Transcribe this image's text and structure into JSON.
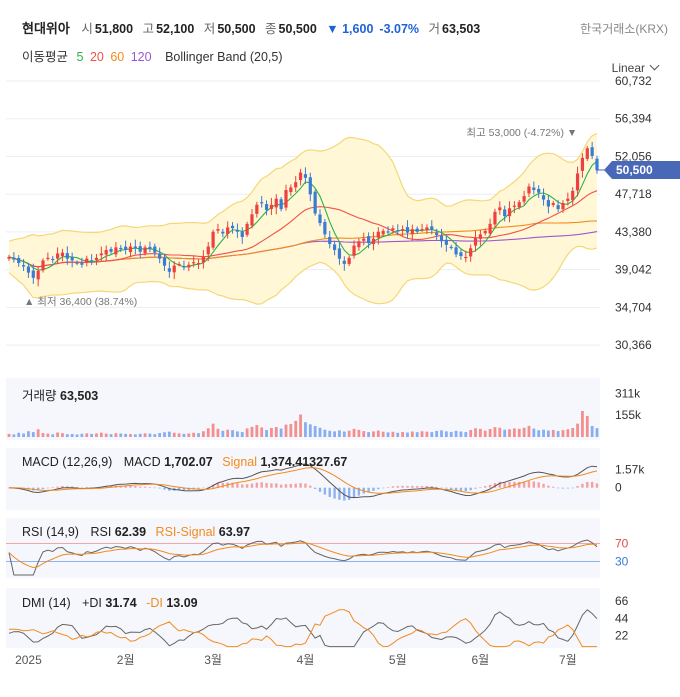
{
  "header": {
    "name": "현대위아",
    "open_label": "시",
    "open": "51,800",
    "high_label": "고",
    "high": "52,100",
    "low_label": "저",
    "low": "50,500",
    "close_label": "종",
    "close": "50,500",
    "change": "▼ 1,600",
    "change_pct": "-3.07%",
    "volume_label": "거",
    "volume": "63,503",
    "exchange": "한국거래소(KRX)"
  },
  "legend": {
    "ma_label": "이동평균",
    "ma_periods": [
      {
        "label": "5",
        "color": "#2bb24c"
      },
      {
        "label": "20",
        "color": "#f2504b"
      },
      {
        "label": "60",
        "color": "#f28b1e"
      },
      {
        "label": "120",
        "color": "#9b59d0"
      }
    ],
    "bb_label": "Bollinger Band (20,5)"
  },
  "scale_mode": "Linear",
  "colors": {
    "up": "#ef3f3f",
    "down": "#3a7bd5",
    "band_fill": "#fff7d6",
    "band_line": "#f5d77a",
    "tag_bg": "#4a68b8"
  },
  "chart_data": [
    {
      "type": "candlestick",
      "title": "",
      "y_ticks": [
        "60,732",
        "56,394",
        "52,056",
        "47,718",
        "43,380",
        "39,042",
        "34,704",
        "30,366"
      ],
      "ylim": [
        27500,
        62000
      ],
      "x_ticks": [
        "2025",
        "2월",
        "3월",
        "4월",
        "5월",
        "6월",
        "7월"
      ],
      "last_price_tag": "50,500",
      "annotations": {
        "max": "최고 53,000 (-4.72%)",
        "min": "최저 36,400 (38.74%)"
      },
      "close": [
        40500,
        40200,
        39800,
        39400,
        38700,
        38100,
        38900,
        40100,
        40400,
        40200,
        40900,
        41000,
        40300,
        40100,
        39800,
        39600,
        40300,
        40100,
        40400,
        40900,
        41300,
        41100,
        41600,
        41500,
        41300,
        41700,
        41500,
        41100,
        41600,
        41400,
        41000,
        40300,
        39500,
        38800,
        39500,
        39700,
        39300,
        39600,
        39900,
        39800,
        40500,
        41700,
        43400,
        43700,
        43200,
        43900,
        43800,
        43400,
        42800,
        44300,
        45400,
        46500,
        46700,
        45900,
        46500,
        47200,
        46000,
        48200,
        48500,
        49100,
        50200,
        49600,
        47700,
        45500,
        44400,
        43100,
        42000,
        41300,
        40300,
        39700,
        40400,
        41800,
        42300,
        42600,
        42100,
        42600,
        43400,
        43500,
        43400,
        43800,
        43500,
        43700,
        43300,
        43700,
        43400,
        43700,
        43900,
        43600,
        43000,
        42300,
        41900,
        41600,
        40800,
        40600,
        40500,
        41500,
        42700,
        43100,
        43500,
        44300,
        45700,
        46200,
        45200,
        46100,
        46400,
        46800,
        47500,
        48600,
        48200,
        47900,
        47100,
        46300,
        46700,
        46000,
        46700,
        47200,
        48100,
        50100,
        51900,
        53000,
        52100,
        50500
      ],
      "volume": [
        22,
        18,
        30,
        25,
        41,
        35,
        55,
        28,
        24,
        19,
        32,
        27,
        20,
        21,
        18,
        23,
        26,
        22,
        25,
        31,
        24,
        20,
        27,
        25,
        22,
        21,
        19,
        23,
        26,
        24,
        20,
        28,
        34,
        38,
        30,
        26,
        22,
        25,
        30,
        27,
        41,
        62,
        95,
        58,
        44,
        52,
        49,
        40,
        35,
        61,
        72,
        85,
        68,
        50,
        64,
        71,
        60,
        88,
        92,
        115,
        160,
        105,
        90,
        78,
        66,
        52,
        44,
        40,
        47,
        39,
        45,
        58,
        51,
        42,
        35,
        40,
        46,
        38,
        33,
        37,
        30,
        36,
        32,
        39,
        34,
        41,
        38,
        35,
        43,
        47,
        40,
        36,
        44,
        39,
        35,
        50,
        62,
        58,
        45,
        57,
        70,
        66,
        52,
        55,
        61,
        58,
        66,
        79,
        60,
        48,
        52,
        46,
        50,
        42,
        49,
        55,
        64,
        95,
        185,
        150,
        78,
        63
      ],
      "volume_ticks": [
        "311k",
        "155k"
      ],
      "ma_colors": [
        "#2bb24c",
        "#f2504b",
        "#f28b1e",
        "#9b59d0"
      ]
    },
    {
      "type": "line",
      "name": "MACD (12,26,9)",
      "labels": {
        "macd": "MACD",
        "macd_value": "1,702.07",
        "signal": "Signal",
        "signal_value": "1,374.41",
        "hist_value": "327.67"
      },
      "y_ticks": [
        "1.57k",
        "0"
      ]
    },
    {
      "type": "line",
      "name": "RSI (14,9)",
      "labels": {
        "rsi": "RSI",
        "rsi_value": "62.39",
        "signal": "RSI-Signal",
        "signal_value": "63.97"
      },
      "y_ticks": [
        "70",
        "30"
      ]
    },
    {
      "type": "line",
      "name": "DMI (14)",
      "labels": {
        "pdi": "+DI",
        "pdi_value": "31.74",
        "mdi": "-DI",
        "mdi_value": "13.09"
      },
      "y_ticks": [
        "66",
        "44",
        "22"
      ]
    }
  ],
  "volume_panel": {
    "label": "거래량",
    "value": "63,503"
  }
}
